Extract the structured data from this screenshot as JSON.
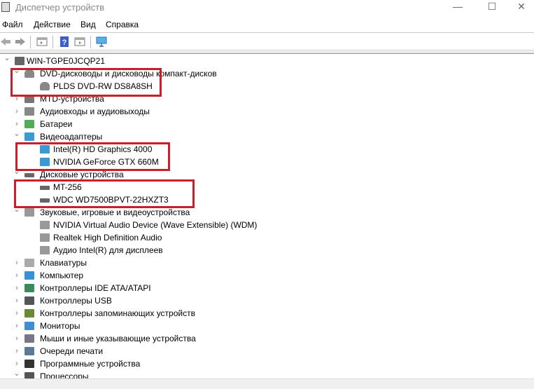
{
  "window": {
    "title": "Диспетчер устройств",
    "minimize": "—",
    "maximize": "☐",
    "close": "✕"
  },
  "menu": [
    "Файл",
    "Действие",
    "Вид",
    "Справка"
  ],
  "toolbar": [
    "back-icon",
    "forward-icon",
    "properties-icon",
    "help-icon",
    "update-driver-icon",
    "scan-hardware-icon"
  ],
  "tree": [
    {
      "level": 0,
      "state": "open",
      "icon": "computer-icon",
      "label": "WIN-TGPE0JCQP21"
    },
    {
      "level": 1,
      "state": "open",
      "icon": "dvd-icon",
      "label": "DVD-дисководы и дисководы компакт-дисков"
    },
    {
      "level": 2,
      "icon": "dvd-icon",
      "label": "PLDS DVD-RW DS8A8SH"
    },
    {
      "level": 1,
      "state": "closed",
      "icon": "mtd-icon",
      "label": "MTD-устройства"
    },
    {
      "level": 1,
      "state": "closed",
      "icon": "audio-icon",
      "label": "Аудиовходы и аудиовыходы"
    },
    {
      "level": 1,
      "state": "closed",
      "icon": "battery-icon",
      "label": "Батареи"
    },
    {
      "level": 1,
      "state": "open",
      "icon": "display-adapter-icon",
      "label": "Видеоадаптеры"
    },
    {
      "level": 2,
      "icon": "display-adapter-icon",
      "label": "Intel(R) HD Graphics 4000"
    },
    {
      "level": 2,
      "icon": "display-adapter-icon",
      "label": "NVIDIA GeForce GTX 660M"
    },
    {
      "level": 1,
      "state": "open",
      "icon": "disk-icon",
      "label": "Дисковые устройства"
    },
    {
      "level": 2,
      "icon": "disk-icon",
      "label": "MT-256"
    },
    {
      "level": 2,
      "icon": "disk-icon",
      "label": "WDC WD7500BPVT-22HXZT3"
    },
    {
      "level": 1,
      "state": "open",
      "icon": "sound-icon",
      "label": "Звуковые, игровые и видеоустройства"
    },
    {
      "level": 2,
      "icon": "sound-icon",
      "label": "NVIDIA Virtual Audio Device (Wave Extensible) (WDM)"
    },
    {
      "level": 2,
      "icon": "sound-icon",
      "label": "Realtek High Definition Audio"
    },
    {
      "level": 2,
      "icon": "sound-icon",
      "label": "Аудио Intel(R) для дисплеев"
    },
    {
      "level": 1,
      "state": "closed",
      "icon": "keyboard-icon",
      "label": "Клавиатуры"
    },
    {
      "level": 1,
      "state": "closed",
      "icon": "monitor-icon",
      "label": "Компьютер"
    },
    {
      "level": 1,
      "state": "closed",
      "icon": "ide-controller-icon",
      "label": "Контроллеры IDE ATA/ATAPI"
    },
    {
      "level": 1,
      "state": "closed",
      "icon": "usb-icon",
      "label": "Контроллеры USB"
    },
    {
      "level": 1,
      "state": "closed",
      "icon": "storage-controller-icon",
      "label": "Контроллеры запоминающих устройств"
    },
    {
      "level": 1,
      "state": "closed",
      "icon": "monitor-icon",
      "label": "Мониторы"
    },
    {
      "level": 1,
      "state": "closed",
      "icon": "mouse-icon",
      "label": "Мыши и иные указывающие устройства"
    },
    {
      "level": 1,
      "state": "closed",
      "icon": "printer-icon",
      "label": "Очереди печати"
    },
    {
      "level": 1,
      "state": "closed",
      "icon": "software-device-icon",
      "label": "Программные устройства"
    },
    {
      "level": 1,
      "state": "open",
      "icon": "processor-icon",
      "label": "Процессоры"
    }
  ],
  "colors": {
    "highlight": "#c8202a",
    "icon_blue": "#3a8fd6",
    "icon_gray": "#6b6b6b"
  }
}
